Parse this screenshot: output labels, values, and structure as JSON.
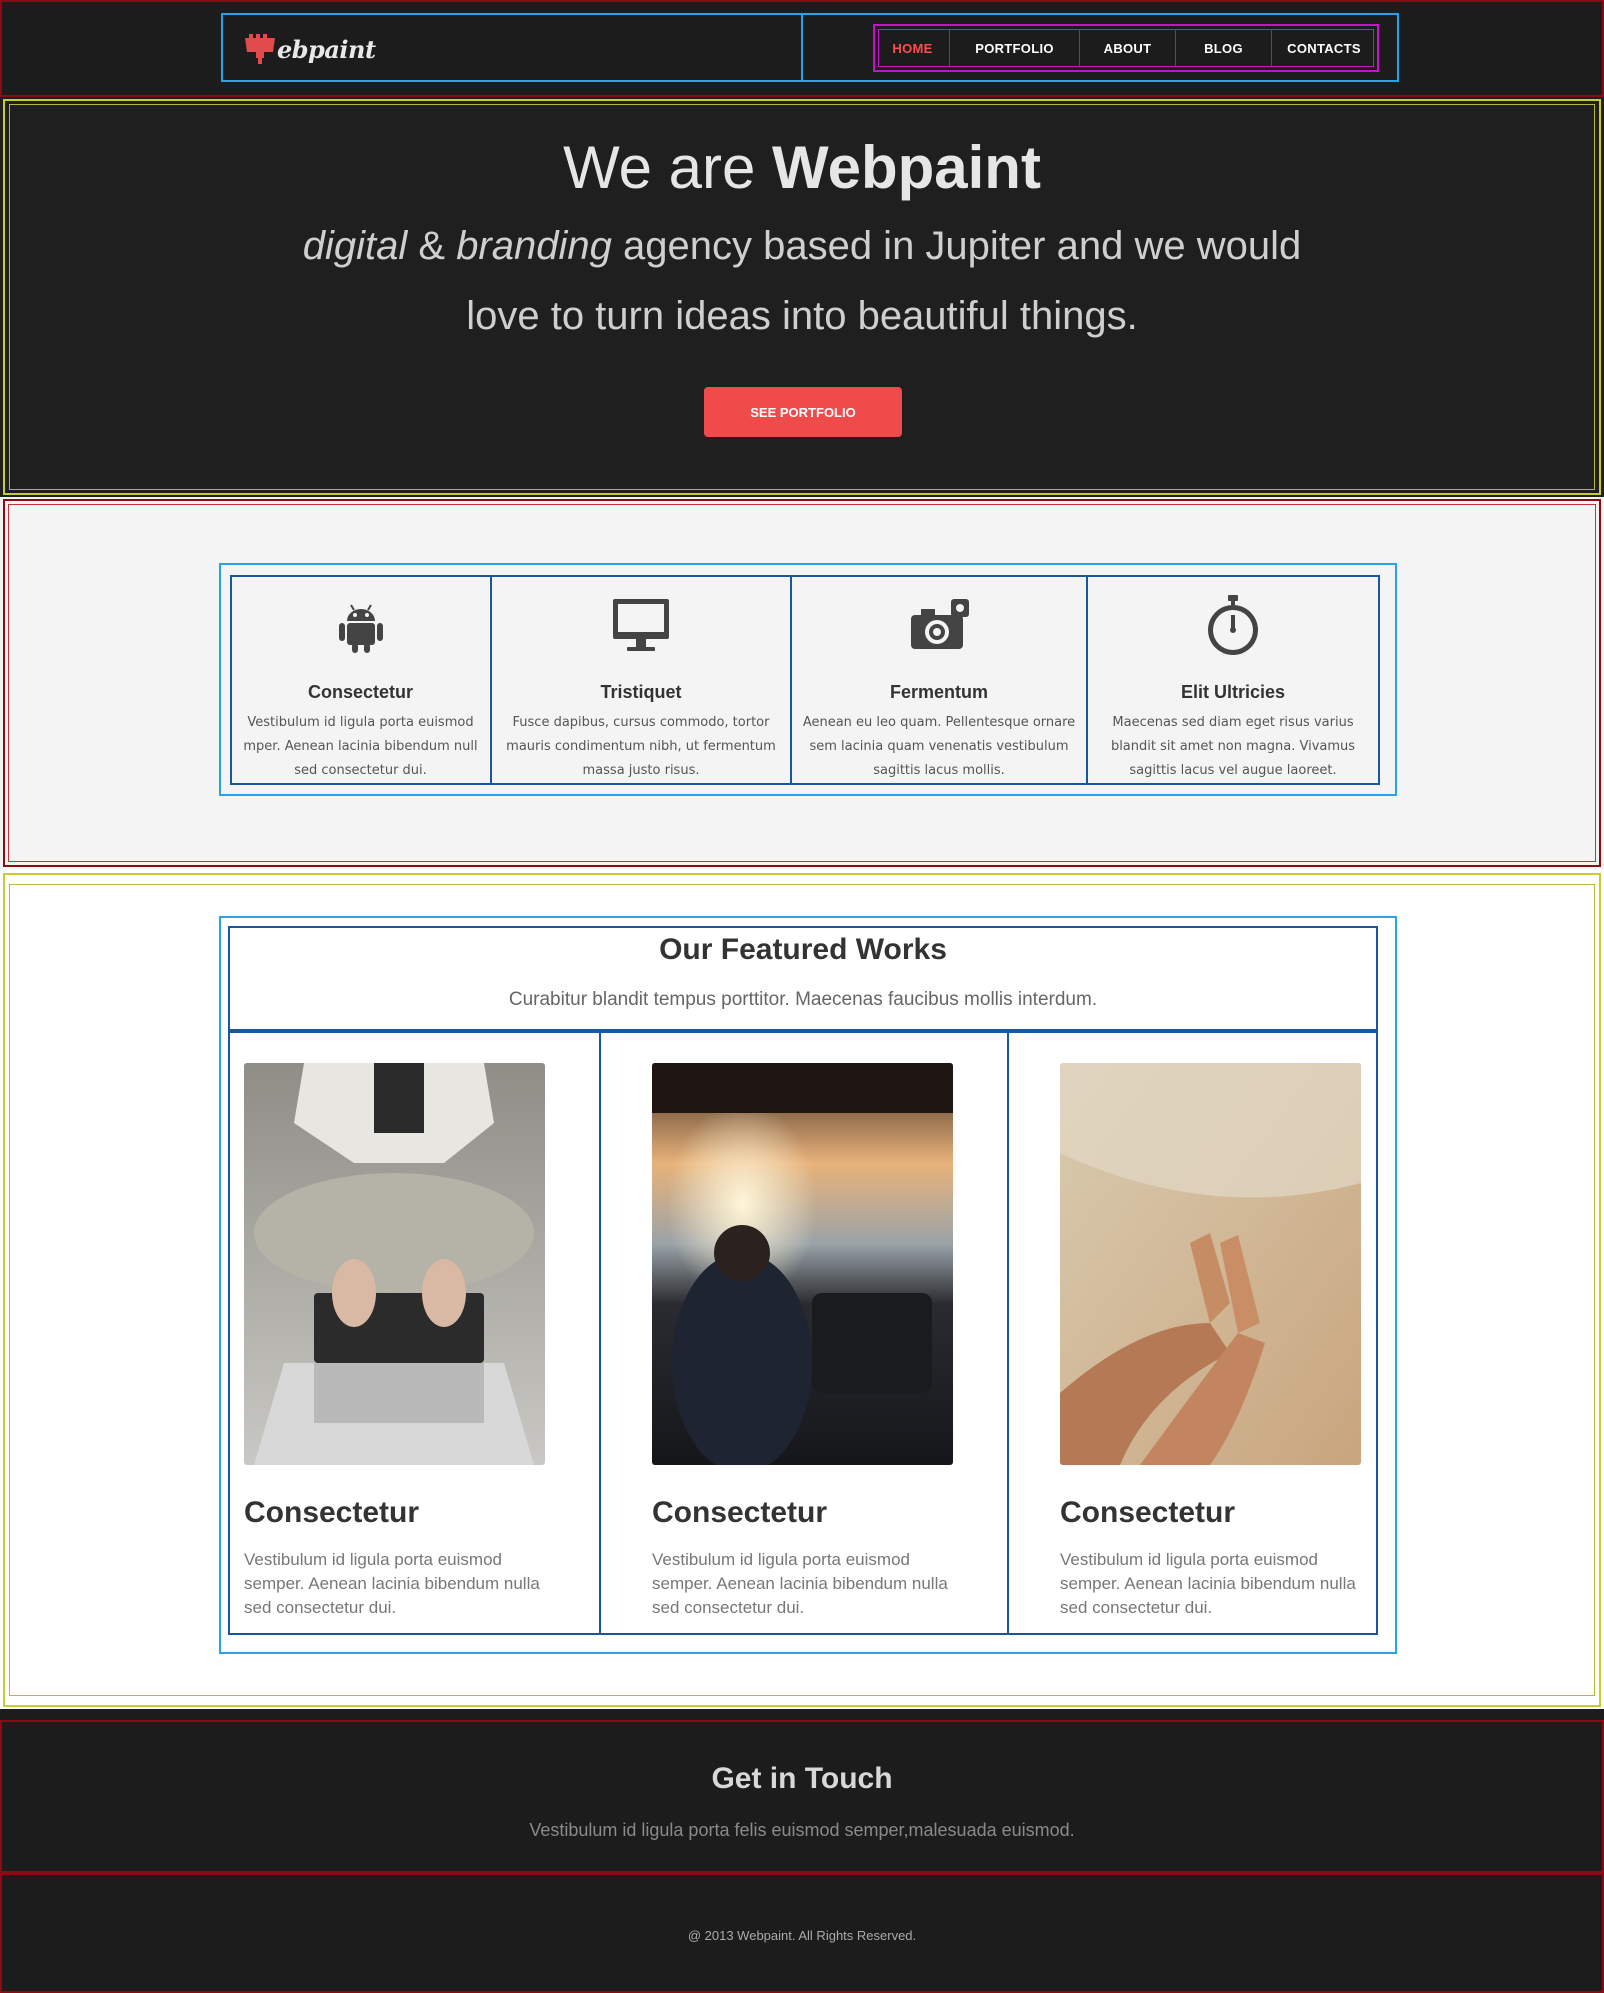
{
  "header": {
    "logo_text": "ebpaint",
    "nav": [
      {
        "label": "HOME",
        "active": true
      },
      {
        "label": "PORTFOLIO",
        "active": false
      },
      {
        "label": "ABOUT",
        "active": false
      },
      {
        "label": "BLOG",
        "active": false
      },
      {
        "label": "CONTACTS",
        "active": false
      }
    ]
  },
  "hero": {
    "title_prefix": "We are ",
    "title_brand": "Webpaint",
    "sub_italic_1": "digital",
    "sub_amp": " & ",
    "sub_italic_2": "branding",
    "sub_rest_1": " agency based in Jupiter and we would",
    "sub_rest_2": "love to turn ideas into beautiful things.",
    "button": "SEE PORTFOLIO"
  },
  "services": [
    {
      "icon": "android-icon",
      "title": "Consectetur",
      "text": "Vestibulum id ligula porta euismod mper. Aenean lacinia bibendum null sed consectetur dui."
    },
    {
      "icon": "monitor-icon",
      "title": "Tristiquet",
      "text": "Fusce dapibus, cursus commodo, tortor mauris condimentum nibh, ut fermentum massa justo risus."
    },
    {
      "icon": "camera-icon",
      "title": "Fermentum",
      "text": "Aenean eu leo quam. Pellentesque ornare sem lacinia quam venenatis vestibulum sagittis lacus mollis."
    },
    {
      "icon": "stopwatch-icon",
      "title": "Elit Ultricies",
      "text": "Maecenas sed diam eget risus varius blandit sit amet non magna. Vivamus sagittis lacus vel augue laoreet."
    }
  ],
  "featured": {
    "title": "Our Featured Works",
    "subtitle": "Curabitur blandit tempus porttitor. Maecenas faucibus mollis interdum.",
    "cards": [
      {
        "image": "laptop-photo",
        "title": "Consectetur",
        "text": "Vestibulum id ligula porta euismod semper. Aenean lacinia bibendum nulla sed consectetur dui."
      },
      {
        "image": "car-photo",
        "title": "Consectetur",
        "text": "Vestibulum id ligula porta euismod semper. Aenean lacinia bibendum nulla sed consectetur dui."
      },
      {
        "image": "beach-legs-photo",
        "title": "Consectetur",
        "text": "Vestibulum id ligula porta euismod semper. Aenean lacinia bibendum nulla sed consectetur dui."
      }
    ]
  },
  "contact": {
    "title": "Get in Touch",
    "text": "Vestibulum id ligula porta felis euismod semper,malesuada euismod."
  },
  "footer": {
    "copyright": "@ 2013 Webpaint. All Rights Reserved."
  },
  "colors": {
    "accent": "#f04b4b",
    "dark_bg": "#1c1c1c",
    "light_bg": "#f4f4f4"
  }
}
